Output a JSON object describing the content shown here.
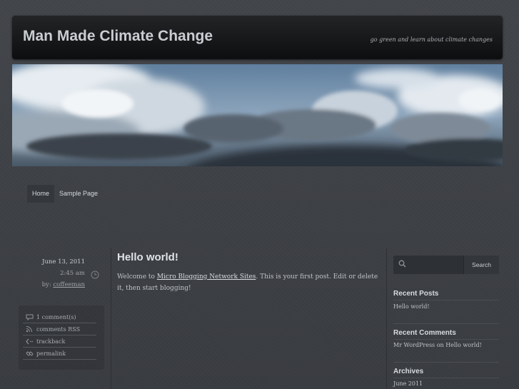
{
  "header": {
    "site_title": "Man Made Climate Change",
    "site_description": "go green and learn about climate changes"
  },
  "nav": {
    "items": [
      {
        "label": "Home",
        "active": true
      },
      {
        "label": "Sample Page",
        "active": false
      }
    ]
  },
  "post": {
    "date": "June 13, 2011",
    "time": "2:45 am",
    "by_label": "by:",
    "author": "coffeeman",
    "title": "Hello world!",
    "body_before_link": "Welcome to ",
    "body_link": "Micro Blogging Network Sites",
    "body_after_link": ". This is your first post. Edit or delete it, then start blogging!",
    "actions": [
      {
        "label": "1 comment(s)",
        "icon": "comment-icon"
      },
      {
        "label": "comments RSS",
        "icon": "rss-icon"
      },
      {
        "label": "trackback",
        "icon": "trackback-icon"
      },
      {
        "label": "permalink",
        "icon": "link-icon"
      }
    ]
  },
  "sidebar": {
    "search": {
      "placeholder": "",
      "button_label": "Search"
    },
    "recent_posts": {
      "title": "Recent Posts",
      "items": [
        "Hello world!"
      ]
    },
    "recent_comments": {
      "title": "Recent Comments",
      "items": [
        "Mr WordPress on Hello world!"
      ]
    },
    "archives": {
      "title": "Archives",
      "items": [
        "June 2011"
      ]
    }
  },
  "colors": {
    "background": "#3c3f44",
    "header": "#0d0e0f",
    "title_text": "#c9cdd2"
  }
}
